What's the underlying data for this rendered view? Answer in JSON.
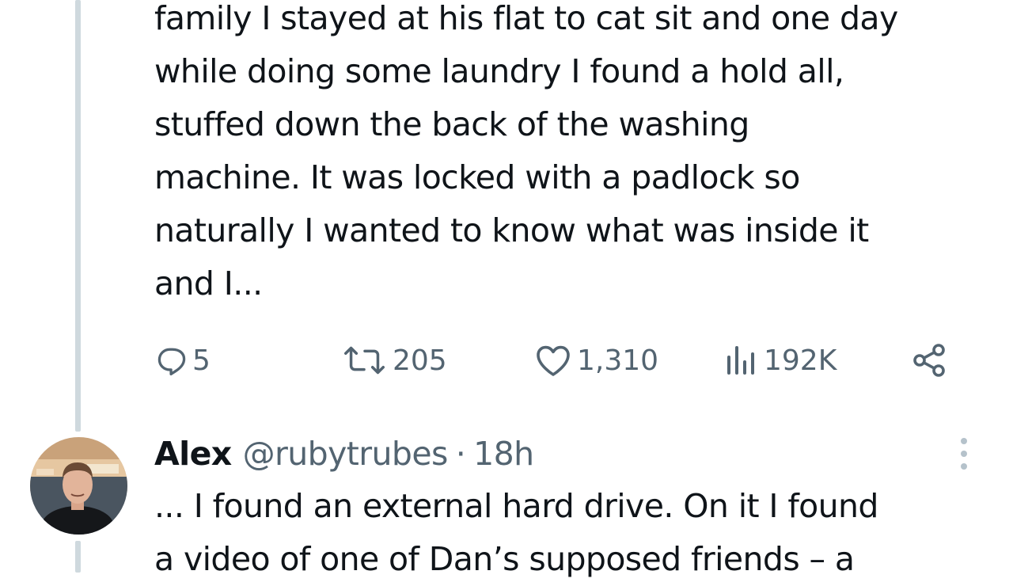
{
  "tweet1": {
    "text": "family I stayed at his flat to cat sit and one day\nwhile doing some laundry I found a hold all,\nstuffed down the back of the washing\nmachine. It was locked with a padlock so\nnaturally I wanted to know what was inside it\nand I...",
    "actions": {
      "replies": "5",
      "retweets": "205",
      "likes": "1,310",
      "views": "192K"
    },
    "icons": [
      "reply-icon",
      "retweet-icon",
      "like-icon",
      "views-icon",
      "share-icon"
    ]
  },
  "tweet2": {
    "author_name": "Alex",
    "author_handle": "@rubytrubes",
    "separator": "·",
    "time": "18h",
    "text": "... I found an external hard drive. On it I found\na video of one of Dan’s supposed friends – a"
  },
  "colors": {
    "text": "#0f1419",
    "secondary": "#536471",
    "thread_line": "#cfd9de",
    "background": "#ffffff"
  }
}
